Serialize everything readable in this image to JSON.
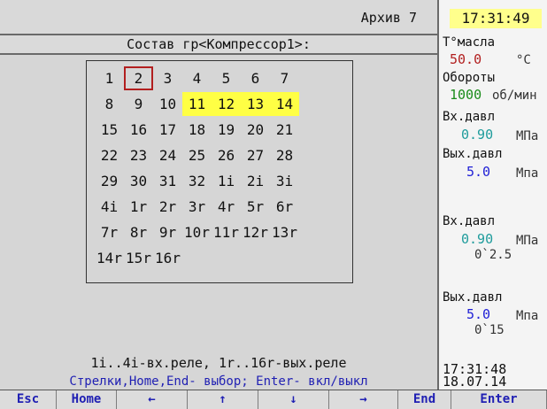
{
  "header": {
    "archive": "Архив 7",
    "title": "Состав гр<Компрессор1>:"
  },
  "grid": {
    "selected": "2",
    "cells": [
      {
        "t": "1",
        "on": false
      },
      {
        "t": "2",
        "on": false
      },
      {
        "t": "3",
        "on": false
      },
      {
        "t": "4",
        "on": false
      },
      {
        "t": "5",
        "on": false
      },
      {
        "t": "6",
        "on": false
      },
      {
        "t": "7",
        "on": false
      },
      {
        "t": "8",
        "on": false
      },
      {
        "t": "9",
        "on": false
      },
      {
        "t": "10",
        "on": false
      },
      {
        "t": "11",
        "on": true
      },
      {
        "t": "12",
        "on": true
      },
      {
        "t": "13",
        "on": true
      },
      {
        "t": "14",
        "on": true
      },
      {
        "t": "15",
        "on": false
      },
      {
        "t": "16",
        "on": false
      },
      {
        "t": "17",
        "on": false
      },
      {
        "t": "18",
        "on": false
      },
      {
        "t": "19",
        "on": false
      },
      {
        "t": "20",
        "on": false
      },
      {
        "t": "21",
        "on": false
      },
      {
        "t": "22",
        "on": false
      },
      {
        "t": "23",
        "on": false
      },
      {
        "t": "24",
        "on": false
      },
      {
        "t": "25",
        "on": false
      },
      {
        "t": "26",
        "on": false
      },
      {
        "t": "27",
        "on": false
      },
      {
        "t": "28",
        "on": false
      },
      {
        "t": "29",
        "on": false
      },
      {
        "t": "30",
        "on": false
      },
      {
        "t": "31",
        "on": false
      },
      {
        "t": "32",
        "on": false
      },
      {
        "t": "1i",
        "on": false
      },
      {
        "t": "2i",
        "on": false
      },
      {
        "t": "3i",
        "on": false
      },
      {
        "t": "4i",
        "on": false
      },
      {
        "t": "1r",
        "on": false
      },
      {
        "t": "2r",
        "on": false
      },
      {
        "t": "3r",
        "on": false
      },
      {
        "t": "4r",
        "on": false
      },
      {
        "t": "5r",
        "on": false
      },
      {
        "t": "6r",
        "on": false
      },
      {
        "t": "7r",
        "on": false
      },
      {
        "t": "8r",
        "on": false
      },
      {
        "t": "9r",
        "on": false
      },
      {
        "t": "10r",
        "on": false
      },
      {
        "t": "11r",
        "on": false
      },
      {
        "t": "12r",
        "on": false
      },
      {
        "t": "13r",
        "on": false
      },
      {
        "t": "14r",
        "on": false
      },
      {
        "t": "15r",
        "on": false
      },
      {
        "t": "16r",
        "on": false
      }
    ]
  },
  "hints": {
    "line1": "1i..4i-вх.реле, 1r..16r-вых.реле",
    "line2": "Стрелки,Home,End- выбор; Enter- вкл/выкл"
  },
  "right": {
    "clock": "17:31:49",
    "oil_label": "Т°масла",
    "oil_value": "50.0",
    "oil_unit": "°С",
    "rpm_label": "Обороты",
    "rpm_value": "1000",
    "rpm_unit": "об/мин",
    "in_label": "Вх.давл",
    "in_value": "0.90",
    "in_unit": "МПа",
    "out_label": "Вых.давл",
    "out_value": "5.0",
    "out_unit": "Мпа",
    "in2_label": "Вх.давл",
    "in2_value": "0.90",
    "in2_unit": "МПа",
    "in2_range": "0`2.5",
    "out2_label": "Вых.давл",
    "out2_value": "5.0",
    "out2_unit": "Мпа",
    "out2_range": "0`15",
    "time": "17:31:48",
    "date": "18.07.14"
  },
  "fkeys": [
    "Esc",
    "Home",
    "←",
    "↑",
    "↓",
    "→",
    "End",
    "Enter"
  ],
  "colors": {
    "highlight": "#ffff44",
    "clock_bg": "#ffff8c",
    "red_value": "#b21f1f",
    "green_value": "#1a8c1a",
    "teal_value": "#1f9c9c",
    "blue_value": "#1f1fd6"
  }
}
